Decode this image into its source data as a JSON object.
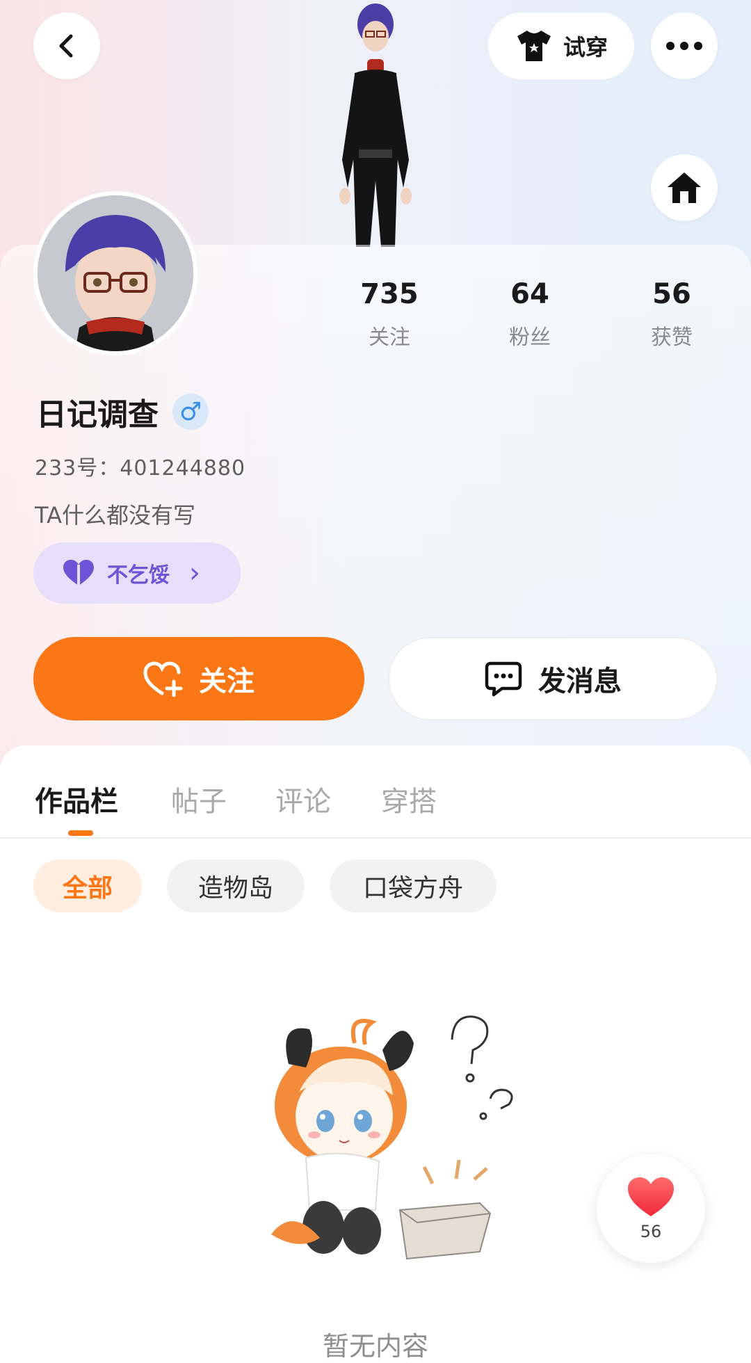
{
  "header": {
    "tryon_label": "试穿"
  },
  "profile": {
    "stats": [
      {
        "value": "735",
        "label": "关注"
      },
      {
        "value": "64",
        "label": "粉丝"
      },
      {
        "value": "56",
        "label": "获赞"
      }
    ],
    "username": "日记调查",
    "gender_symbol": "♂",
    "user_id": "233号：401244880",
    "bio": "TA什么都没有写",
    "tag_label": "不乞馁",
    "tag_chevron": "›"
  },
  "actions": {
    "follow_label": "关注",
    "message_label": "发消息"
  },
  "tabs": [
    {
      "label": "作品栏",
      "active": true
    },
    {
      "label": "帖子",
      "active": false
    },
    {
      "label": "评论",
      "active": false
    },
    {
      "label": "穿搭",
      "active": false
    }
  ],
  "filters": [
    {
      "label": "全部",
      "active": true
    },
    {
      "label": "造物岛",
      "active": false
    },
    {
      "label": "口袋方舟",
      "active": false
    }
  ],
  "empty_state": {
    "text": "暂无内容"
  },
  "like_float": {
    "count": "56"
  },
  "colors": {
    "accent": "#fb7614",
    "tag_purple": "#6c54d6",
    "gender_blue": "#3b8ee8"
  },
  "icons": [
    "back-arrow-icon",
    "tshirt-icon",
    "more-dots-icon",
    "home-icon",
    "heart-icon",
    "heart-plus-icon",
    "chat-bubble-icon",
    "chevron-right-icon"
  ]
}
